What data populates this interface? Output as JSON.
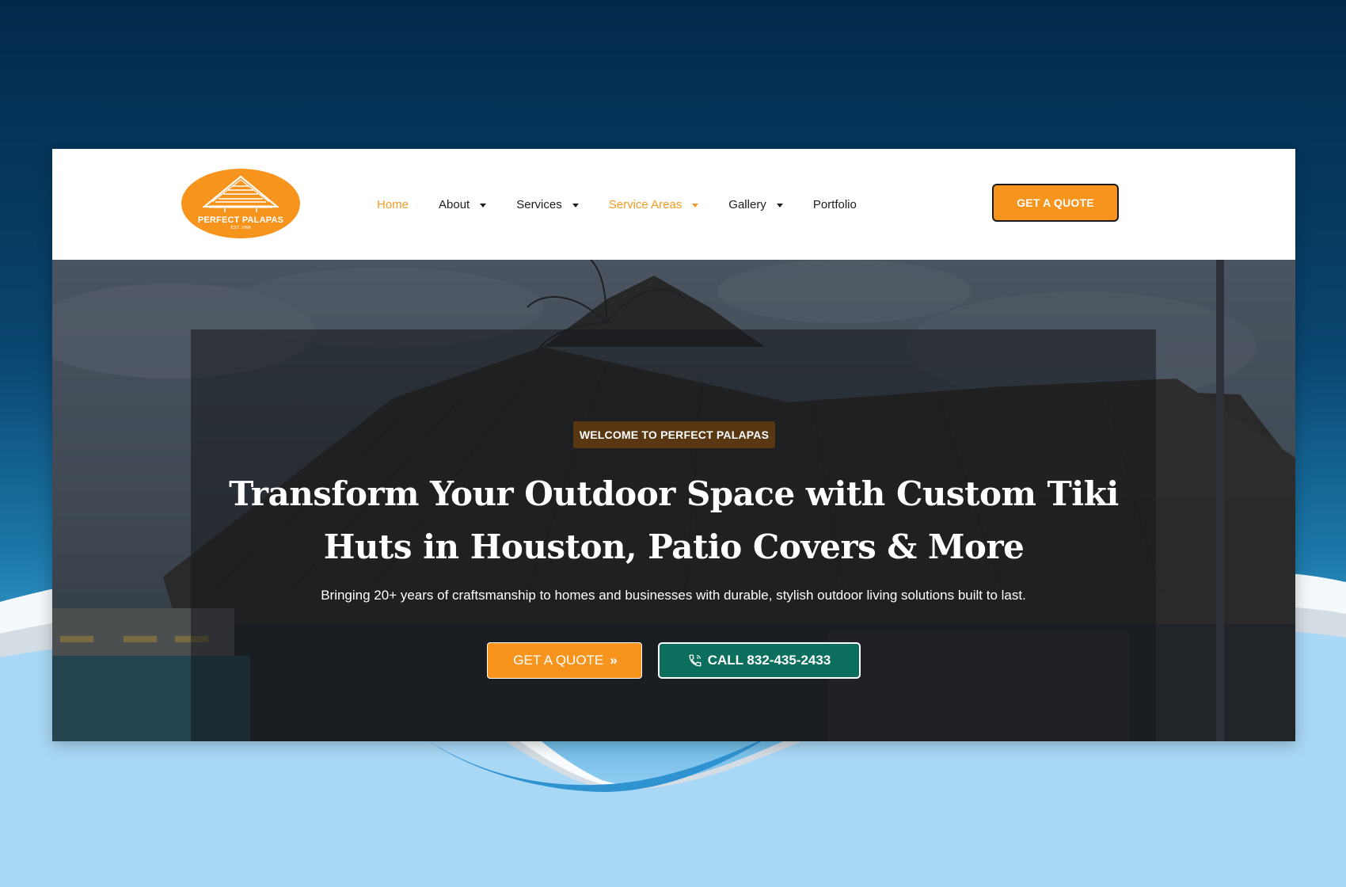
{
  "brand": {
    "name": "PERFECT PALAPAS",
    "established": "EST. 1998"
  },
  "nav": {
    "items": [
      {
        "label": "Home",
        "has_dropdown": false,
        "active": true
      },
      {
        "label": "About",
        "has_dropdown": true,
        "active": false
      },
      {
        "label": "Services",
        "has_dropdown": true,
        "active": false
      },
      {
        "label": "Service Areas",
        "has_dropdown": true,
        "active": true
      },
      {
        "label": "Gallery",
        "has_dropdown": true,
        "active": false
      },
      {
        "label": "Portfolio",
        "has_dropdown": false,
        "active": false
      }
    ]
  },
  "header": {
    "cta_label": "GET A QUOTE"
  },
  "hero": {
    "badge": "WELCOME TO PERFECT PALAPAS",
    "title_line1": "Transform Your Outdoor Space with Custom Tiki",
    "title_line2": "Huts in Houston, Patio Covers & More",
    "subtitle": "Bringing 20+ years of craftsmanship to homes and businesses with durable, stylish outdoor living solutions built to last.",
    "quote_button": "GET A QUOTE",
    "quote_arrows": "»",
    "call_button": "CALL 832-435-2433"
  },
  "icons": {
    "logo": "palapa-roof-icon",
    "caret": "caret-down-icon",
    "phone": "phone-icon",
    "arrows": "double-chevron-right-icon"
  },
  "colors": {
    "accent_orange": "#f7941d",
    "nav_active": "#f39a26",
    "badge_brown": "#5a3713",
    "call_green": "#0c6e5c",
    "backdrop_navy": "#02294a"
  }
}
